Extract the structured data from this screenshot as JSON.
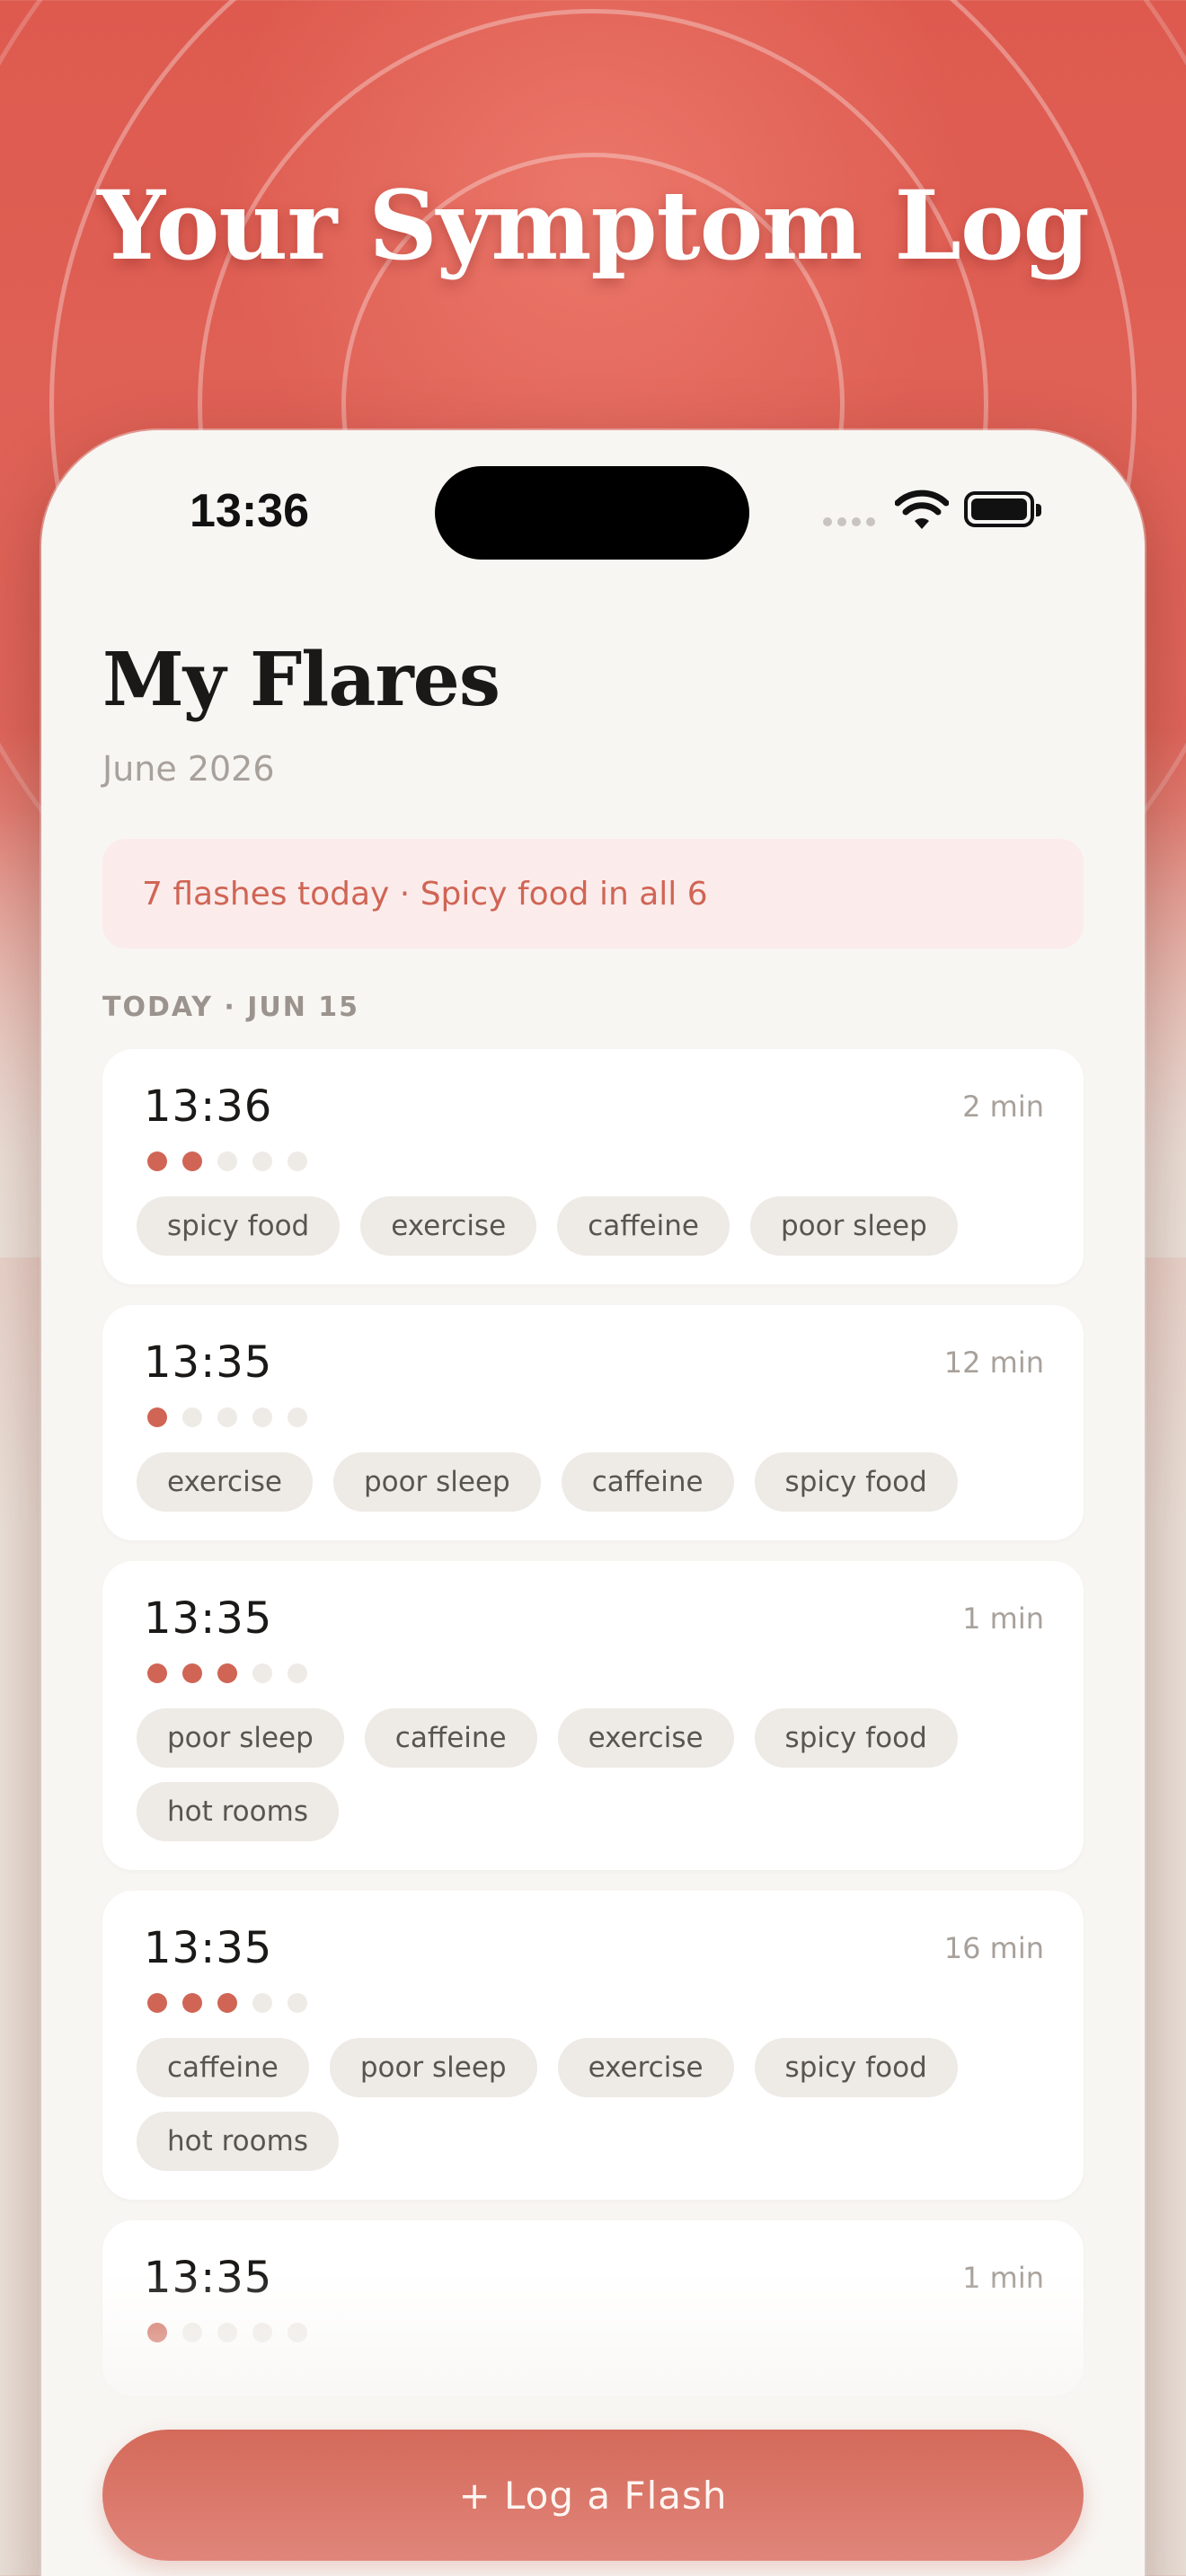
{
  "headline": "Your Symptom Log",
  "status_bar": {
    "time": "13:36",
    "wifi_icon": "wifi-icon",
    "battery_icon": "battery-icon"
  },
  "screen": {
    "title": "My Flares",
    "subtitle": "June 2026",
    "summary": "7 flashes today · Spicy food in all 6",
    "section_label": "TODAY · JUN 15"
  },
  "entries": [
    {
      "time": "13:36",
      "duration": "2 min",
      "severity": 2,
      "severity_max": 5,
      "tags": [
        "spicy food",
        "exercise",
        "caffeine",
        "poor sleep"
      ]
    },
    {
      "time": "13:35",
      "duration": "12 min",
      "severity": 1,
      "severity_max": 5,
      "tags": [
        "exercise",
        "poor sleep",
        "caffeine",
        "spicy food"
      ]
    },
    {
      "time": "13:35",
      "duration": "1 min",
      "severity": 3,
      "severity_max": 5,
      "tags": [
        "poor sleep",
        "caffeine",
        "exercise",
        "spicy food",
        "hot rooms"
      ]
    },
    {
      "time": "13:35",
      "duration": "16 min",
      "severity": 3,
      "severity_max": 5,
      "tags": [
        "caffeine",
        "poor sleep",
        "exercise",
        "spicy food",
        "hot rooms"
      ]
    },
    {
      "time": "13:35",
      "duration": "1 min",
      "severity": 1,
      "severity_max": 5,
      "tags": []
    }
  ],
  "cta_label": "+ Log a Flash",
  "colors": {
    "accent": "#d06555",
    "background_top": "#de5a4f",
    "card": "#ffffff",
    "tag": "#eeeae6"
  }
}
